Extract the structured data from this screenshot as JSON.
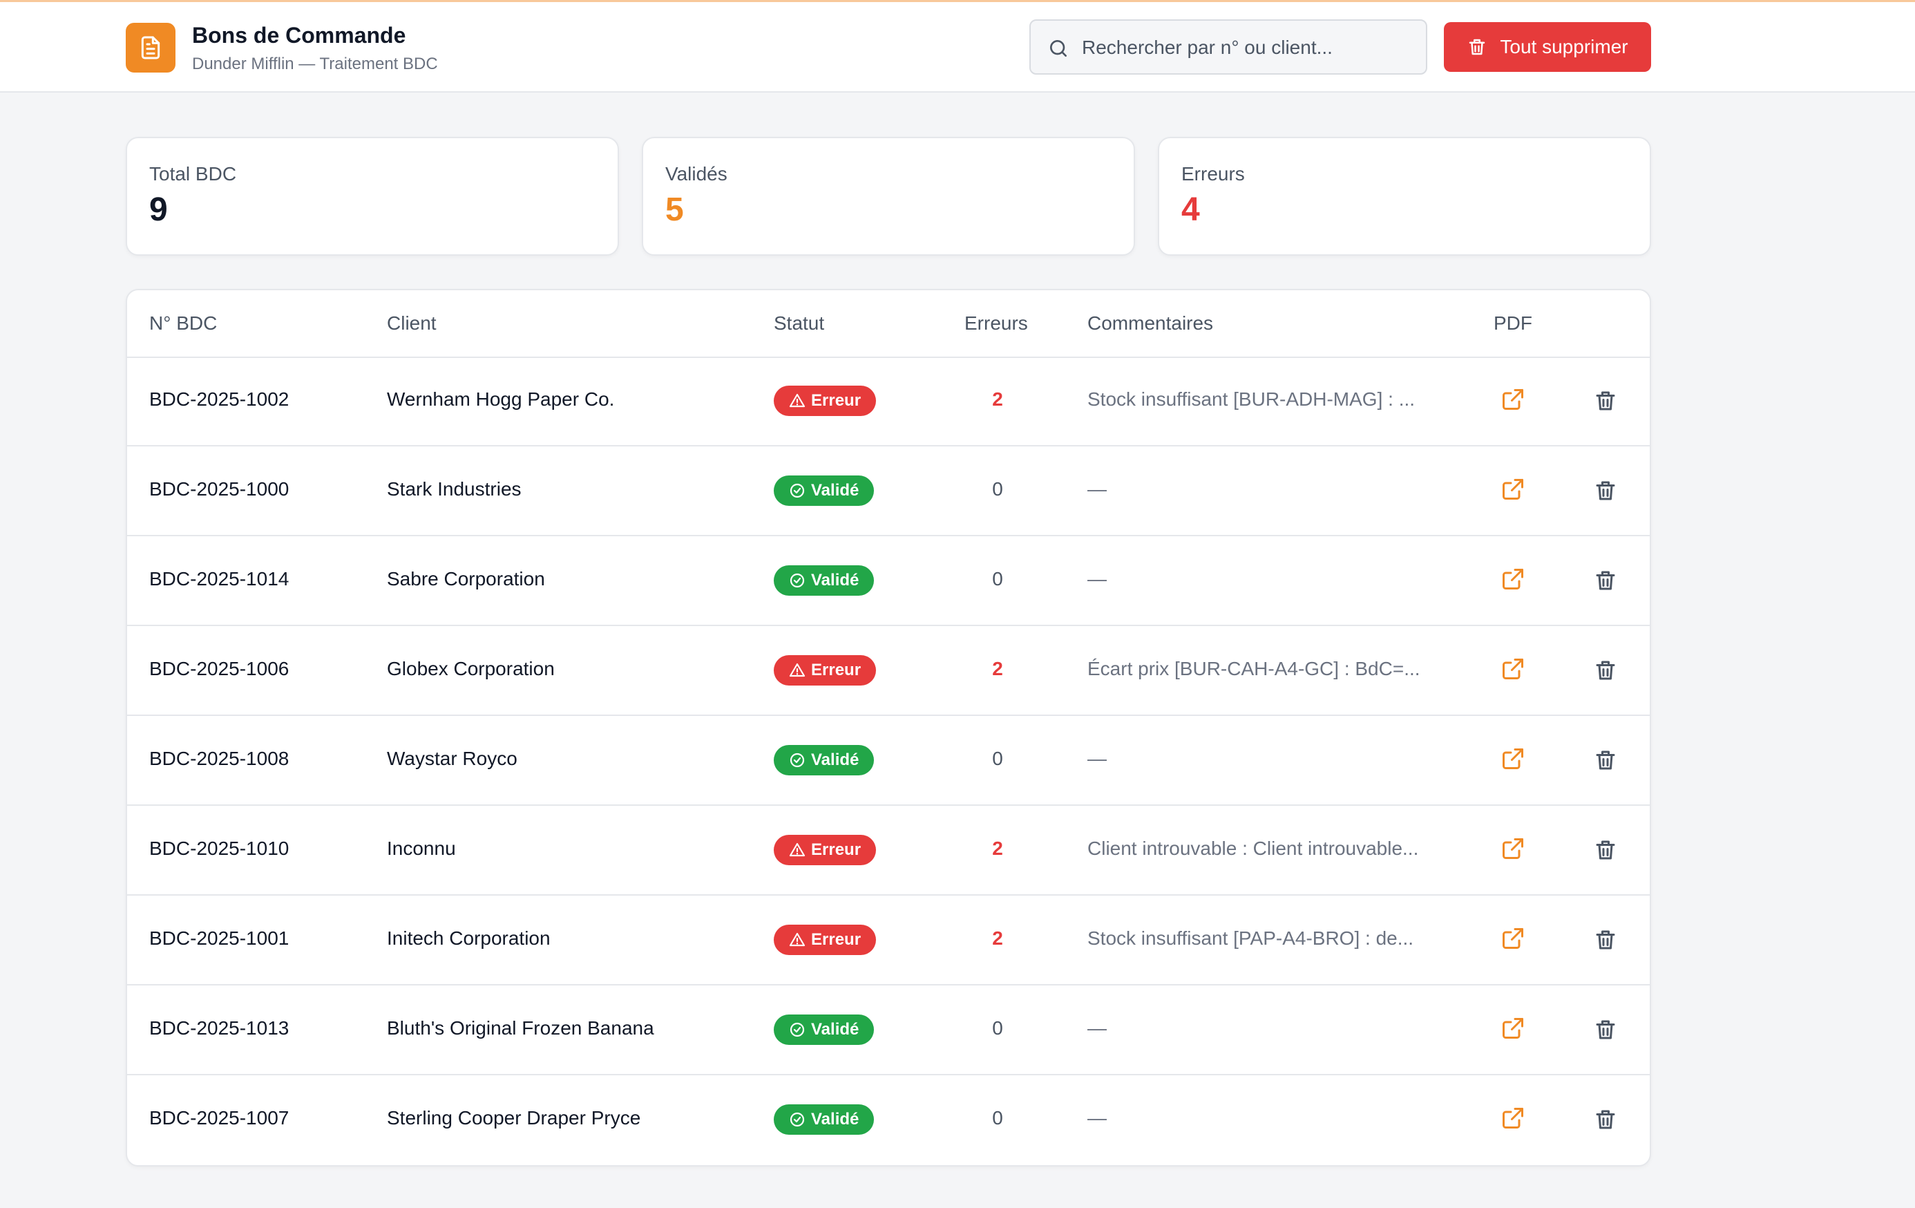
{
  "header": {
    "title": "Bons de Commande",
    "subtitle": "Dunder Mifflin — Traitement BDC",
    "search_placeholder": "Rechercher par n° ou client...",
    "delete_all_label": "Tout supprimer"
  },
  "stats": [
    {
      "label": "Total BDC",
      "value": "9",
      "color": "#111827"
    },
    {
      "label": "Validés",
      "value": "5",
      "color": "#f08a24"
    },
    {
      "label": "Erreurs",
      "value": "4",
      "color": "#e63b3b"
    }
  ],
  "table": {
    "headers": [
      "N° BDC",
      "Client",
      "Statut",
      "Erreurs",
      "Commentaires",
      "PDF"
    ],
    "rows": [
      {
        "id": "BDC-2025-1002",
        "client": "Wernham Hogg Paper Co.",
        "status": "Erreur",
        "errors": "2",
        "comment": "Stock insuffisant [BUR-ADH-MAG] : ..."
      },
      {
        "id": "BDC-2025-1000",
        "client": "Stark Industries",
        "status": "Validé",
        "errors": "0",
        "comment": "—"
      },
      {
        "id": "BDC-2025-1014",
        "client": "Sabre Corporation",
        "status": "Validé",
        "errors": "0",
        "comment": "—"
      },
      {
        "id": "BDC-2025-1006",
        "client": "Globex Corporation",
        "status": "Erreur",
        "errors": "2",
        "comment": "Écart prix [BUR-CAH-A4-GC] : BdC=..."
      },
      {
        "id": "BDC-2025-1008",
        "client": "Waystar Royco",
        "status": "Validé",
        "errors": "0",
        "comment": "—"
      },
      {
        "id": "BDC-2025-1010",
        "client": "Inconnu",
        "status": "Erreur",
        "errors": "2",
        "comment": "Client introuvable : Client introuvable..."
      },
      {
        "id": "BDC-2025-1001",
        "client": "Initech Corporation",
        "status": "Erreur",
        "errors": "2",
        "comment": "Stock insuffisant [PAP-A4-BRO] : de..."
      },
      {
        "id": "BDC-2025-1013",
        "client": "Bluth's Original Frozen Banana",
        "status": "Validé",
        "errors": "0",
        "comment": "—"
      },
      {
        "id": "BDC-2025-1007",
        "client": "Sterling Cooper Draper Pryce",
        "status": "Validé",
        "errors": "0",
        "comment": "—"
      }
    ]
  },
  "colors": {
    "accent": "#f08a24",
    "danger": "#e63b3b",
    "success": "#22a648"
  },
  "icons": {
    "logo": "document-icon",
    "search": "search-icon",
    "delete_all": "trash-icon",
    "status_error": "alert-triangle-icon",
    "status_ok": "check-circle-icon",
    "pdf": "external-link-icon",
    "delete_row": "trash-icon"
  }
}
